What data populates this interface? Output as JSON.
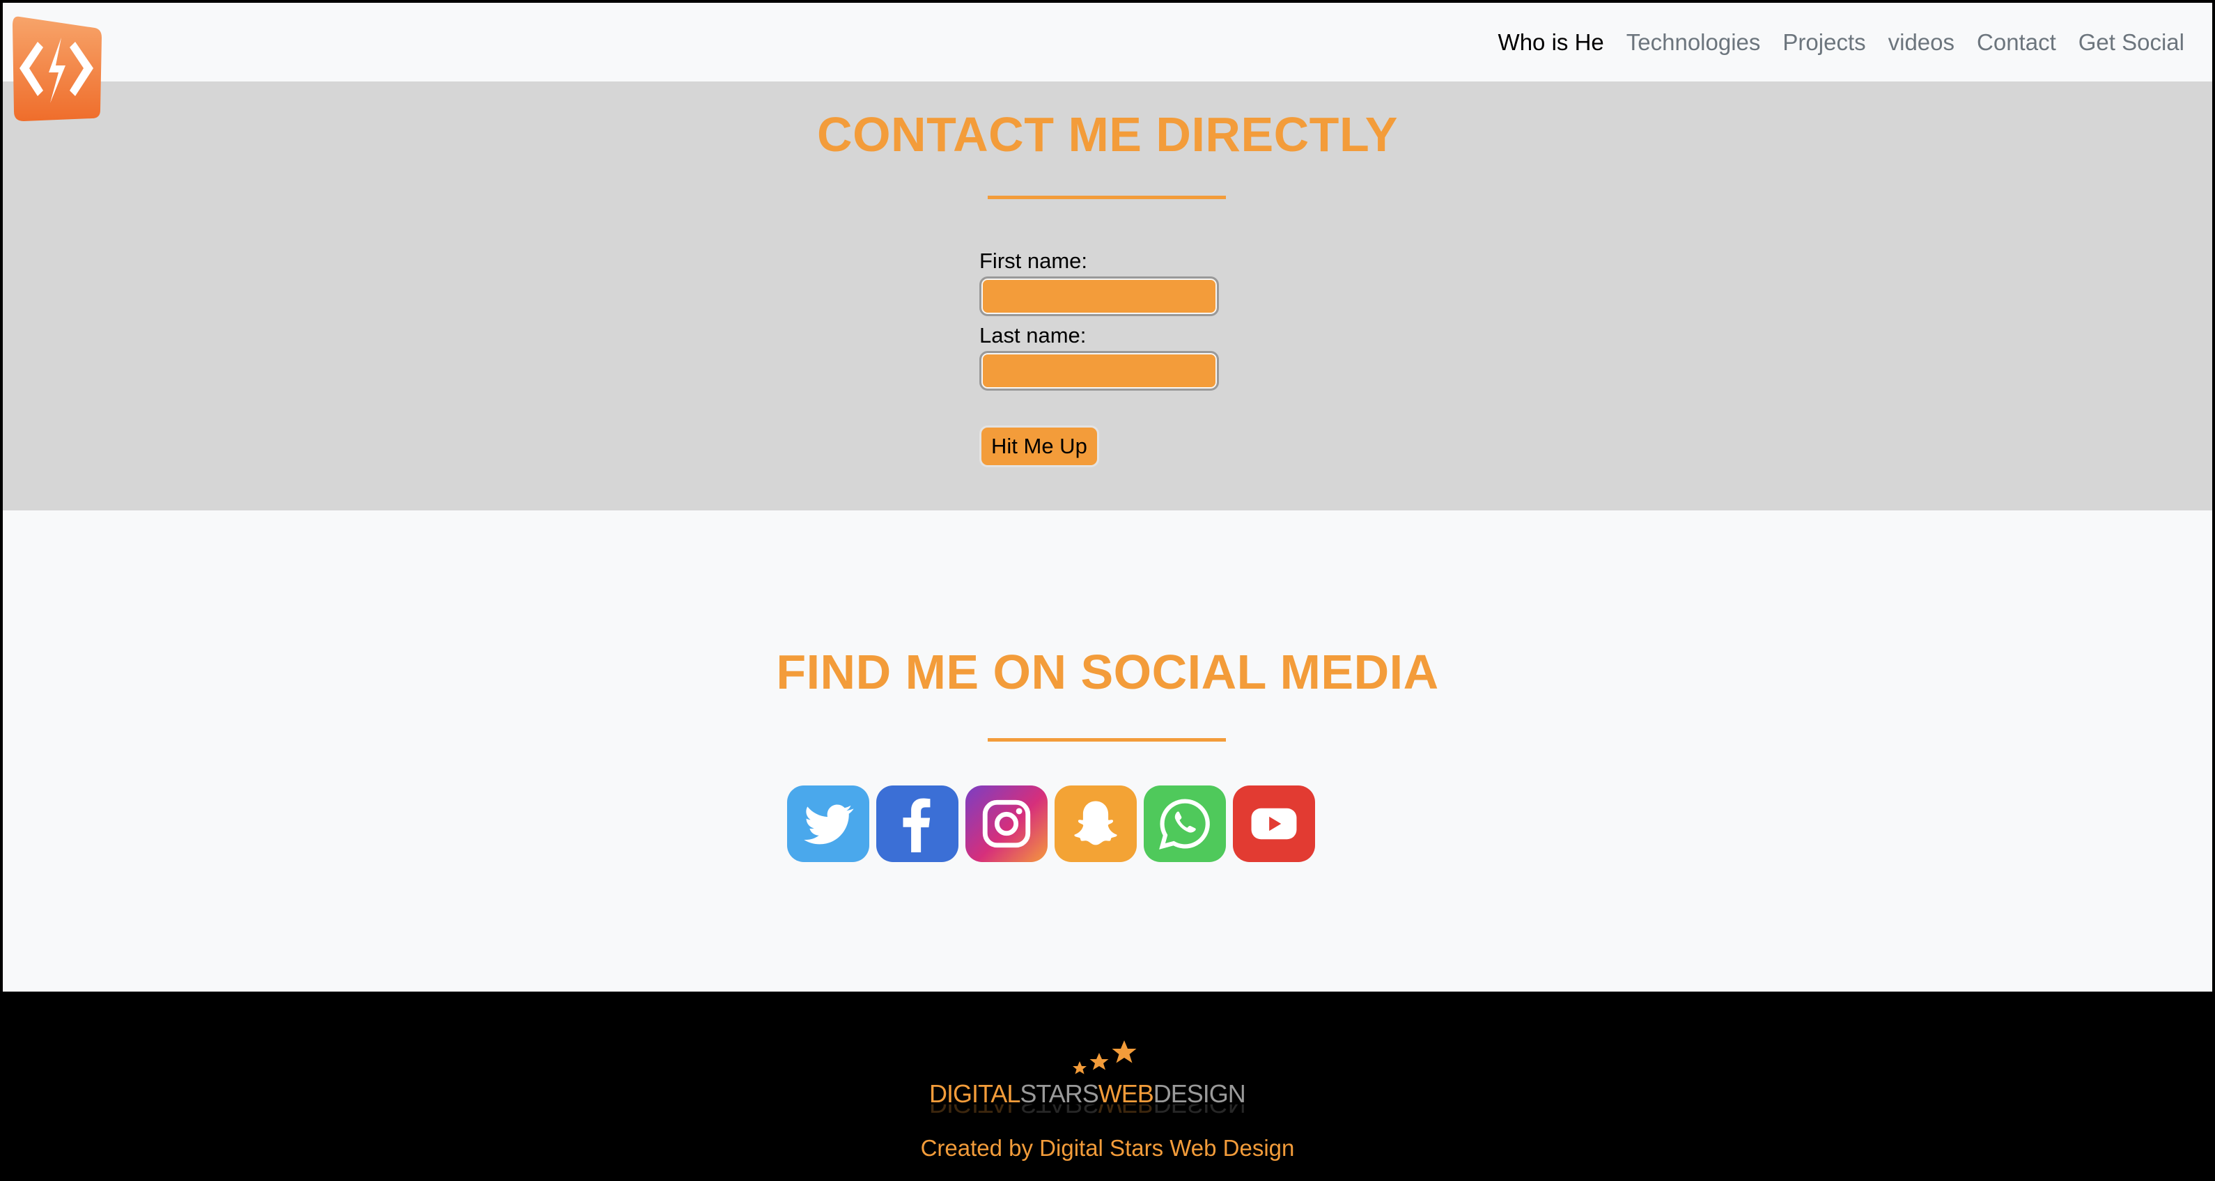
{
  "nav": {
    "logo_icon": "code-brackets-icon",
    "links": [
      {
        "label": "Who is He",
        "active": true
      },
      {
        "label": "Technologies",
        "active": false
      },
      {
        "label": "Projects",
        "active": false
      },
      {
        "label": "videos",
        "active": false
      },
      {
        "label": "Contact",
        "active": false
      },
      {
        "label": "Get Social",
        "active": false
      }
    ]
  },
  "contact": {
    "title": "CONTACT ME DIRECTLY",
    "first_name_label": "First name:",
    "first_name_value": "",
    "last_name_label": "Last name:",
    "last_name_value": "",
    "submit_label": "Hit Me Up"
  },
  "social": {
    "title": "FIND ME ON SOCIAL MEDIA",
    "icons": [
      {
        "name": "twitter-icon",
        "color": "#4aa8ec"
      },
      {
        "name": "facebook-icon",
        "color": "#3b6fd6"
      },
      {
        "name": "instagram-icon",
        "color": "#c13584"
      },
      {
        "name": "snapchat-icon",
        "color": "#f3a335"
      },
      {
        "name": "whatsapp-icon",
        "color": "#4fc95b"
      },
      {
        "name": "youtube-icon",
        "color": "#e23b32"
      }
    ]
  },
  "footer": {
    "brand_part1": "DIGITAL",
    "brand_part2": "STARS",
    "brand_part3": "WEB",
    "brand_part4": "DESIGN",
    "credit": "Created by Digital Stars Web Design"
  },
  "colors": {
    "accent": "#f39c3a",
    "contact_bg": "#d6d6d6",
    "page_bg": "#f8f9fa",
    "footer_bg": "#000000"
  }
}
